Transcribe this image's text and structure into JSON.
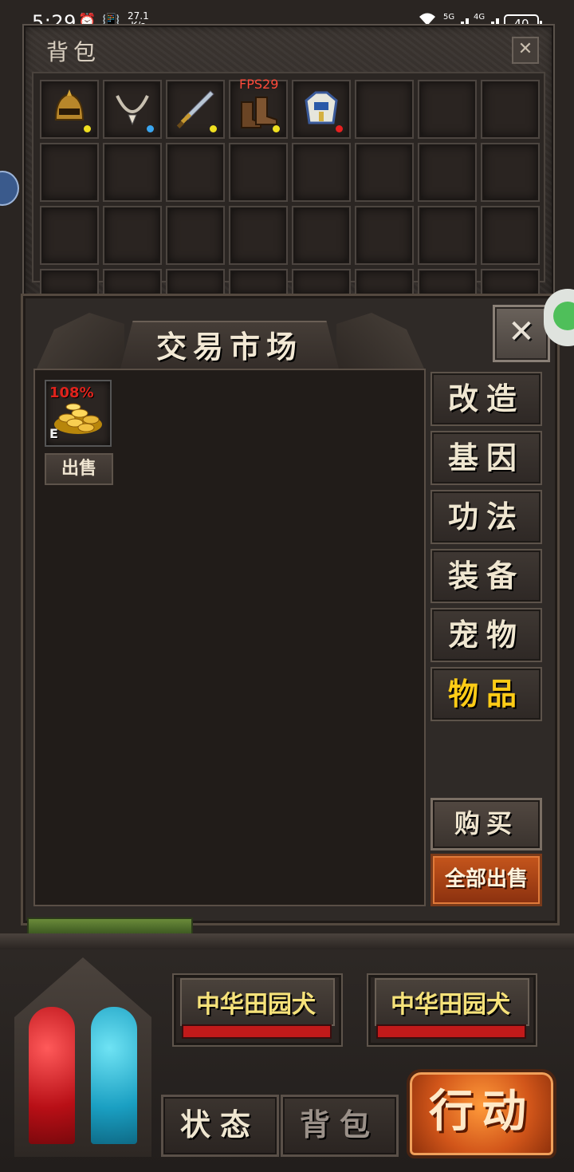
{
  "status_bar": {
    "time": "5:29",
    "speed_value": "27.1",
    "speed_unit": "K/s",
    "network_5g": "5G",
    "network_4g": "4G",
    "battery": "40"
  },
  "backpack": {
    "title": "背包",
    "close": "✕",
    "fps": "FPS29",
    "items": [
      {
        "icon": "helmet-icon",
        "rarity_color": "#f0e020"
      },
      {
        "icon": "necklace-icon",
        "rarity_color": "#3aa6f0"
      },
      {
        "icon": "sword-icon",
        "rarity_color": "#f0e020"
      },
      {
        "icon": "boots-icon",
        "rarity_color": "#f0e020"
      },
      {
        "icon": "armor-icon",
        "rarity_color": "#e82020"
      }
    ]
  },
  "market": {
    "title": "交易市场",
    "close": "✕",
    "listing": {
      "percent": "108%",
      "grade": "E",
      "icon": "gold-coins-icon",
      "sell_label": "出售"
    },
    "tabs": [
      {
        "label": "改造",
        "active": false
      },
      {
        "label": "基因",
        "active": false
      },
      {
        "label": "功法",
        "active": false
      },
      {
        "label": "装备",
        "active": false
      },
      {
        "label": "宠物",
        "active": false
      },
      {
        "label": "物品",
        "active": true
      }
    ],
    "buy_label": "购买",
    "sell_all_label": "全部出售"
  },
  "hud": {
    "enemies": [
      {
        "name": "中华田园犬",
        "hp_fraction": 1.0
      },
      {
        "name": "中华田园犬",
        "hp_fraction": 1.0
      }
    ],
    "status_tab": "状态",
    "bag_tab": "背包",
    "action_label": "行动",
    "colors": {
      "active_tab": "#ffcc16",
      "hp_bar": "#c21a1a"
    }
  }
}
